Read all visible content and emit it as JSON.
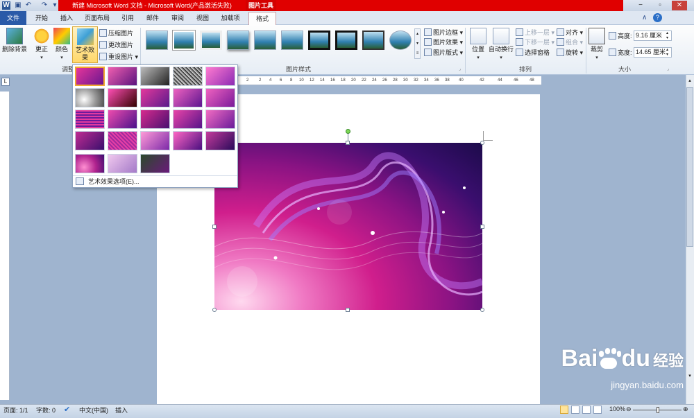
{
  "window": {
    "title": "新建 Microsoft Word 文档 - Microsoft Word(产品激活失败)",
    "contextual_tab_group": "图片工具",
    "window_buttons": [
      "−",
      "▫",
      "✕"
    ]
  },
  "tabs": [
    "文件",
    "开始",
    "插入",
    "页面布局",
    "引用",
    "邮件",
    "审阅",
    "视图",
    "加载项",
    "格式"
  ],
  "ribbon": {
    "adjust": {
      "remove_bg": "删除背景",
      "corrections": "更正",
      "color": "颜色",
      "artistic_effects": "艺术效果",
      "compress": "压缩图片",
      "change": "更改图片",
      "reset": "重设图片",
      "label": "调整"
    },
    "styles": {
      "label": "图片样式",
      "border": "图片边框",
      "effects": "图片效果",
      "layout": "图片版式"
    },
    "arrange": {
      "label": "排列",
      "position": "位置",
      "wrap": "自动换行",
      "bring_forward": "上移一层",
      "send_backward": "下移一层",
      "selection_pane": "选择窗格",
      "align": "对齐",
      "group": "组合",
      "rotate": "旋转"
    },
    "size": {
      "label": "大小",
      "crop": "裁剪",
      "height_label": "高度:",
      "height_value": "9.16 厘米",
      "width_label": "宽度:",
      "width_value": "14.65 厘米"
    }
  },
  "ruler": {
    "ticks": [
      "4",
      "2",
      "2",
      "4",
      "6",
      "8",
      "10",
      "12",
      "14",
      "16",
      "18",
      "20",
      "22",
      "24",
      "26",
      "28",
      "30",
      "32",
      "34",
      "36",
      "38",
      "40",
      "42",
      "44",
      "46",
      "48"
    ]
  },
  "gallery": {
    "footer": "艺术效果选项(E)..."
  },
  "status": {
    "page": "页面: 1/1",
    "words": "字数: 0",
    "language": "中文(中国)",
    "mode": "插入",
    "zoom": "100%"
  },
  "watermark": {
    "brand": "Bai",
    "suffix": "du",
    "jingyan": "经验",
    "url": "jingyan.baidu.com"
  }
}
